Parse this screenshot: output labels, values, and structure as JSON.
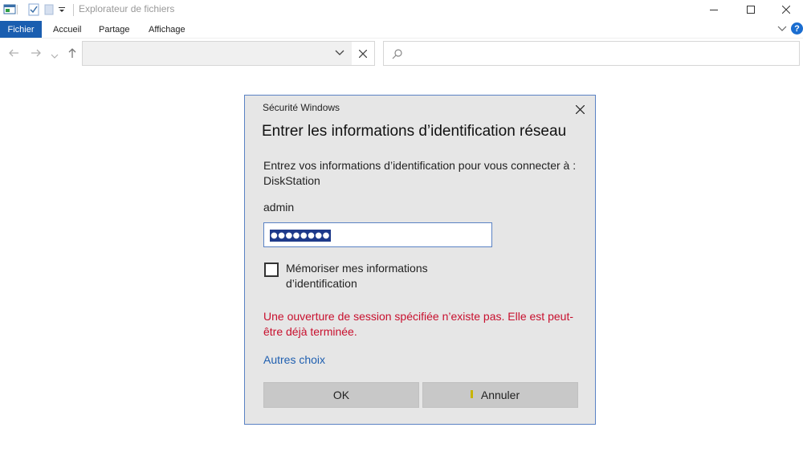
{
  "window": {
    "title": "Explorateur de fichiers"
  },
  "ribbon": {
    "tabs": [
      "Fichier",
      "Accueil",
      "Partage",
      "Affichage"
    ],
    "help_label": "?"
  },
  "dialog": {
    "caption": "Sécurité Windows",
    "heading": "Entrer les informations d’identification réseau",
    "message": "Entrez vos informations d’identification pour vous connecter à : DiskStation",
    "username": "admin",
    "password_mask": "●●●●●●●●",
    "remember_label": "Mémoriser mes informations d’identification",
    "error_message": "Une ouverture de session spécifiée n’existe pas. Elle est peut-être déjà terminée.",
    "more_choices": "Autres choix",
    "ok_label": "OK",
    "cancel_label": "Annuler"
  },
  "colors": {
    "accent": "#1a5eb0",
    "error": "#c8102e",
    "link": "#1f5fb0"
  },
  "icons": [
    "explorer-app-icon",
    "properties-icon",
    "new-folder-icon",
    "qa-dropdown-icon",
    "minimize-icon",
    "maximize-icon",
    "close-icon",
    "back-arrow-icon",
    "forward-arrow-icon",
    "recent-dropdown-icon",
    "up-arrow-icon",
    "chevron-down-icon",
    "clear-icon",
    "search-icon",
    "ribbon-collapse-icon"
  ]
}
